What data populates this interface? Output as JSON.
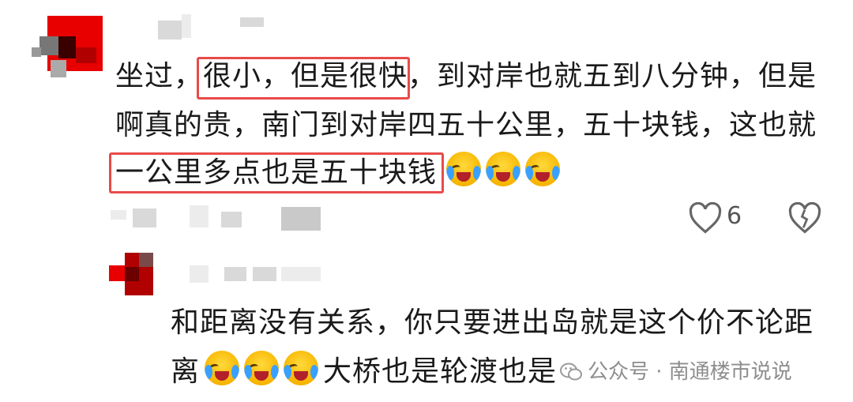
{
  "comment1": {
    "line1_pre": "坐过，",
    "line1_hl": "很小，但是很快",
    "line1_post": "，到对岸也就五到八分钟，但是",
    "line2": "啊真的贵，南门到对岸四五十公里，五十块钱，这也就",
    "line3_hl": "一公里多点也是五十块钱",
    "emoji_name": "crying-laughing-emoji",
    "like_count": "6"
  },
  "comment2": {
    "line1": "和距离没有关系，你只要进出岛就是这个价不论距",
    "line2_pre": "离",
    "line2_post": "大桥也是轮渡也是"
  },
  "watermark": {
    "text": "公众号 · 南通楼市说说"
  },
  "colors": {
    "highlight": "#e84a4a",
    "avatar_red": "#e80000"
  }
}
